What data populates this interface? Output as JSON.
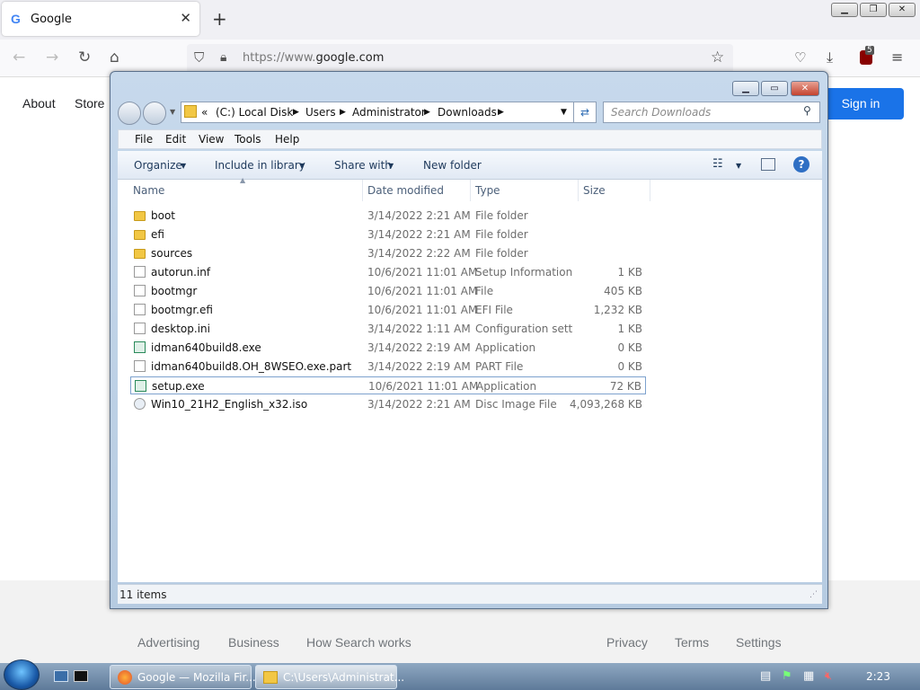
{
  "browser": {
    "tab_title": "Google",
    "tab_favicon": "G",
    "close_glyph": "✕",
    "newtab_glyph": "+",
    "url_prefix": "https://www.",
    "url_domain": "google.com",
    "extension_badge": "5",
    "window_controls": [
      "▁",
      "❐",
      "✕"
    ]
  },
  "google": {
    "top_links": [
      "About",
      "Store"
    ],
    "signin_label": "Sign in",
    "footer_left": [
      "Advertising",
      "Business",
      "How Search works"
    ],
    "footer_right": [
      "Privacy",
      "Terms",
      "Settings"
    ]
  },
  "explorer": {
    "breadcrumb_prefix": "«",
    "breadcrumb": [
      "(C:) Local Disk",
      "Users",
      "Administrator",
      "Downloads"
    ],
    "search_placeholder": "Search Downloads",
    "menu": [
      "File",
      "Edit",
      "View",
      "Tools",
      "Help"
    ],
    "toolbar": [
      "Organize",
      "Include in library",
      "Share with",
      "New folder"
    ],
    "columns": [
      "Name",
      "Date modified",
      "Type",
      "Size"
    ],
    "files": [
      {
        "name": "boot",
        "date": "3/14/2022 2:21 AM",
        "type": "File folder",
        "size": "",
        "icon": "folder"
      },
      {
        "name": "efi",
        "date": "3/14/2022 2:21 AM",
        "type": "File folder",
        "size": "",
        "icon": "folder"
      },
      {
        "name": "sources",
        "date": "3/14/2022 2:22 AM",
        "type": "File folder",
        "size": "",
        "icon": "folder"
      },
      {
        "name": "autorun.inf",
        "date": "10/6/2021 11:01 AM",
        "type": "Setup Information",
        "size": "1 KB",
        "icon": "file"
      },
      {
        "name": "bootmgr",
        "date": "10/6/2021 11:01 AM",
        "type": "File",
        "size": "405 KB",
        "icon": "file"
      },
      {
        "name": "bootmgr.efi",
        "date": "10/6/2021 11:01 AM",
        "type": "EFI File",
        "size": "1,232 KB",
        "icon": "file"
      },
      {
        "name": "desktop.ini",
        "date": "3/14/2022 1:11 AM",
        "type": "Configuration sett...",
        "size": "1 KB",
        "icon": "file"
      },
      {
        "name": "idman640build8.exe",
        "date": "3/14/2022 2:19 AM",
        "type": "Application",
        "size": "0 KB",
        "icon": "app"
      },
      {
        "name": "idman640build8.OH_8WSEO.exe.part",
        "date": "3/14/2022 2:19 AM",
        "type": "PART File",
        "size": "0 KB",
        "icon": "file"
      },
      {
        "name": "setup.exe",
        "date": "10/6/2021 11:01 AM",
        "type": "Application",
        "size": "72 KB",
        "icon": "app"
      },
      {
        "name": "Win10_21H2_English_x32.iso",
        "date": "3/14/2022 2:21 AM",
        "type": "Disc Image File",
        "size": "4,093,268 KB",
        "icon": "disc"
      }
    ],
    "selected_file": "setup.exe",
    "status": "11 items",
    "help_glyph": "?"
  },
  "taskbar": {
    "buttons": [
      "Google — Mozilla Fir...",
      "C:\\Users\\Administrat..."
    ],
    "clock": "2:23"
  }
}
